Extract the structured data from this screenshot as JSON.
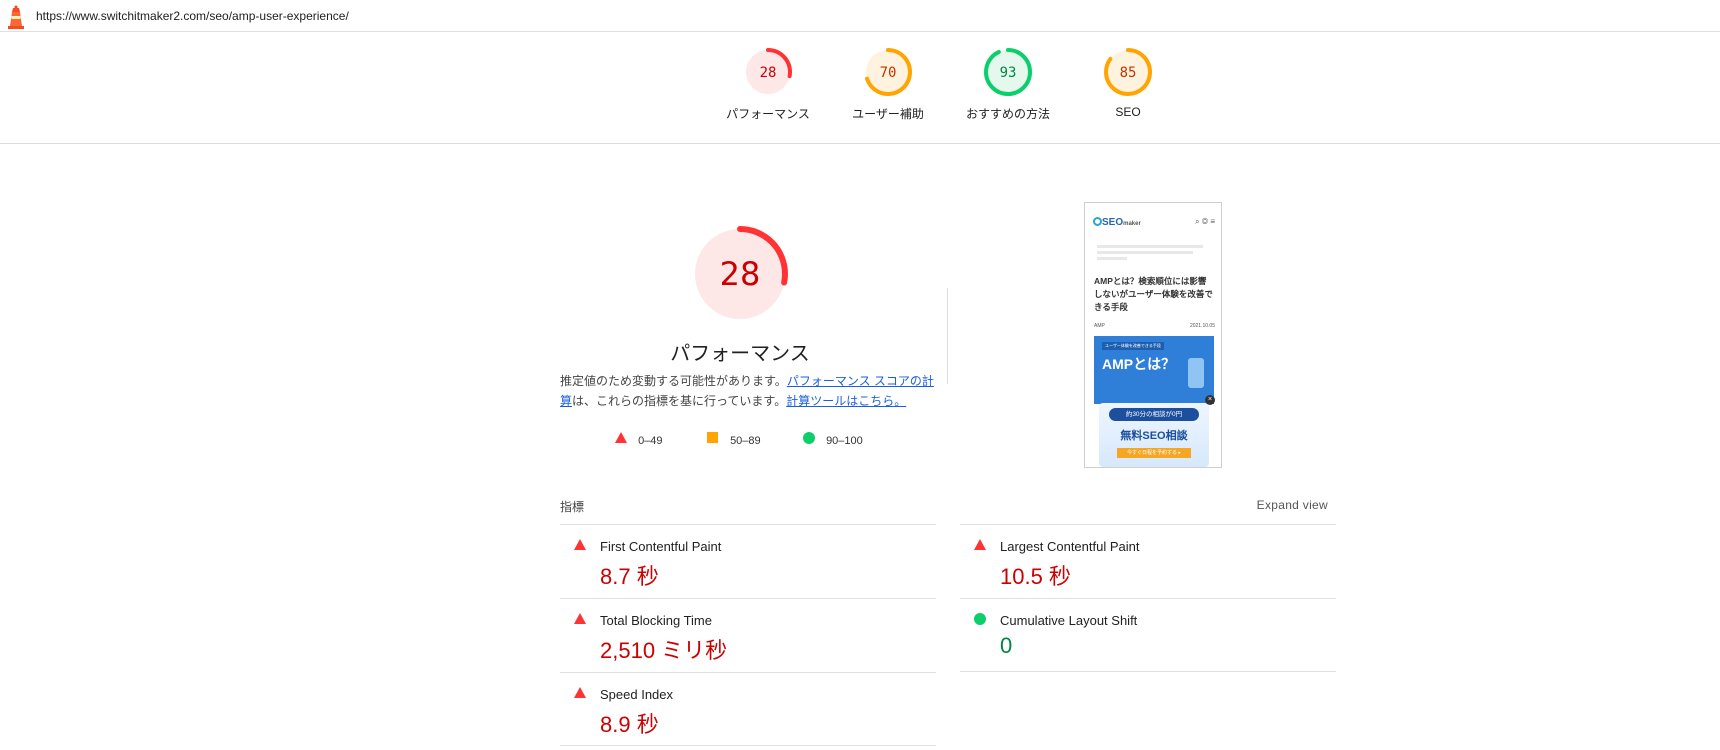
{
  "url": "https://www.switchitmaker2.com/seo/amp-user-experience/",
  "colors": {
    "fail": "#ff3333",
    "average": "#ffa400",
    "pass": "#0cce6b",
    "fail_text": "#cc0000",
    "pass_text": "#018642"
  },
  "gauges": [
    {
      "score": "28",
      "label": "パフォーマンス",
      "level": "fail",
      "fraction": 0.28
    },
    {
      "score": "70",
      "label": "ユーザー補助",
      "level": "average",
      "fraction": 0.7
    },
    {
      "score": "93",
      "label": "おすすめの方法",
      "level": "pass",
      "fraction": 0.93
    },
    {
      "score": "85",
      "label": "SEO",
      "level": "average",
      "fraction": 0.85
    }
  ],
  "main": {
    "score": "28",
    "fraction": 0.28,
    "title": "パフォーマンス",
    "desc_before": "推定値のため変動する可能性があります。",
    "desc_link1": "パフォーマンス スコアの計算",
    "desc_middle": "は、これらの指標を基に行っています。",
    "desc_link2": "計算ツールはこちら。"
  },
  "legend": [
    {
      "icon": "triangle-icon",
      "range": "0–49"
    },
    {
      "icon": "square-icon",
      "range": "50–89"
    },
    {
      "icon": "circle-icon",
      "range": "90–100"
    }
  ],
  "screenshot": {
    "brand": "SEO",
    "brand_sub": "maker",
    "headline": "AMPとは？検索順位には影響しないがユーザー体験を改善できる手段",
    "tag": "AMP",
    "date": "2021.10.05",
    "banner_title": "AMPとは？",
    "banner_tag": "ユーザー体験を改善できる手段",
    "popup_line": "約30分の相談が0円",
    "popup_title": "無料SEO相談",
    "popup_btn": "今すぐ日程を予約する ▸"
  },
  "metrics_header": "指標",
  "expand_label": "Expand view",
  "metrics": [
    {
      "name": "First Contentful Paint",
      "value": "8.7 秒",
      "level": "fail",
      "icon": "triangle-icon"
    },
    {
      "name": "Largest Contentful Paint",
      "value": "10.5 秒",
      "level": "fail",
      "icon": "triangle-icon"
    },
    {
      "name": "Total Blocking Time",
      "value": "2,510 ミリ秒",
      "level": "fail",
      "icon": "triangle-icon"
    },
    {
      "name": "Cumulative Layout Shift",
      "value": "0",
      "level": "pass",
      "icon": "circle-icon"
    },
    {
      "name": "Speed Index",
      "value": "8.9 秒",
      "level": "fail",
      "icon": "triangle-icon"
    }
  ]
}
